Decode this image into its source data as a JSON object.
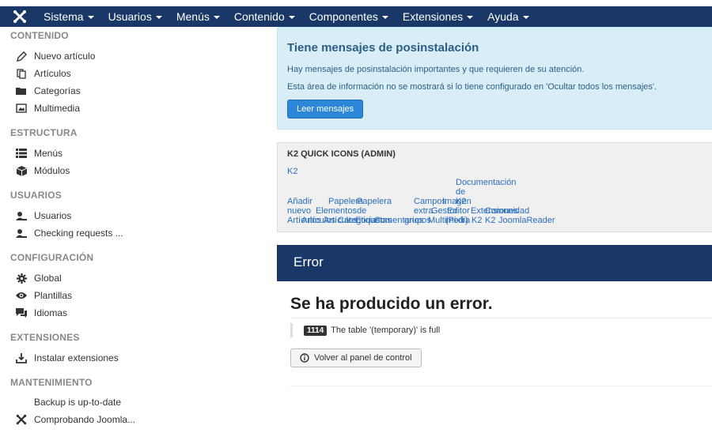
{
  "navbar": {
    "logo_icon": "joomla-logo-icon",
    "items": [
      {
        "label": "Sistema"
      },
      {
        "label": "Usuarios"
      },
      {
        "label": "Menús"
      },
      {
        "label": "Contenido"
      },
      {
        "label": "Componentes"
      },
      {
        "label": "Extensiones"
      },
      {
        "label": "Ayuda"
      }
    ]
  },
  "sidebar": {
    "sections": [
      {
        "heading": "CONTENIDO",
        "items": [
          {
            "label": "Nuevo artículo",
            "icon": "pencil-icon"
          },
          {
            "label": "Artículos",
            "icon": "copy-icon"
          },
          {
            "label": "Categorías",
            "icon": "folder-icon"
          },
          {
            "label": "Multimedia",
            "icon": "image-icon"
          }
        ]
      },
      {
        "heading": "ESTRUCTURA",
        "items": [
          {
            "label": "Menús",
            "icon": "list-icon"
          },
          {
            "label": "Módulos",
            "icon": "cube-icon"
          }
        ]
      },
      {
        "heading": "USUARIOS",
        "items": [
          {
            "label": "Usuarios",
            "icon": "users-icon"
          },
          {
            "label": "Checking requests ...",
            "icon": "users-icon"
          }
        ]
      },
      {
        "heading": "CONFIGURACIÓN",
        "items": [
          {
            "label": "Global",
            "icon": "cog-icon"
          },
          {
            "label": "Plantillas",
            "icon": "eye-icon"
          },
          {
            "label": "Idiomas",
            "icon": "comments-icon"
          }
        ]
      },
      {
        "heading": "EXTENSIONES",
        "items": [
          {
            "label": "Instalar extensiones",
            "icon": "upload-icon"
          }
        ]
      },
      {
        "heading": "MANTENIMIENTO",
        "items": [
          {
            "label": "Backup is up-to-date",
            "icon": ""
          },
          {
            "label": "Comprobando Joomla...",
            "icon": "joomla-icon"
          }
        ]
      }
    ]
  },
  "postinstall": {
    "title": "Tiene mensajes de posinstalación",
    "line1": "Hay mensajes de posinstalación importantes y que requieren de su atención.",
    "line2": "Esta área de información no se mostrará si lo tiene configurado en 'Ocultar todos los mensajes'.",
    "button_label": "Leer mensajes"
  },
  "k2": {
    "heading": "K2 QUICK ICONS (ADMIN)",
    "k2_link": "K2",
    "fragments": [
      "Documentación",
      "de",
      "K2",
      "Añadir",
      "Papelera",
      "Papelera",
      "Campos",
      "Imagen",
      "nuevo",
      "Elementos",
      "de",
      "extra",
      "Gestor",
      "Editor",
      "Extensiones",
      "Comunidad",
      "Artículos",
      "Artículos",
      "Artículos",
      "Categorías",
      "Etiquetas",
      "Comentarios",
      "grupos",
      "Multimedia",
      "(Pixlr)",
      "K2",
      "K2",
      "JoomlaReader"
    ]
  },
  "error": {
    "header": "Error",
    "title": "Se ha producido un error.",
    "code": "1114",
    "message": "The table '(temporary)' is full",
    "back_button": "Volver al panel de control"
  },
  "colors": {
    "navbar": "#1a3867",
    "info_bg": "#d9edf7",
    "primary_button": "#2d87d8",
    "link": "#2a6ebb"
  }
}
